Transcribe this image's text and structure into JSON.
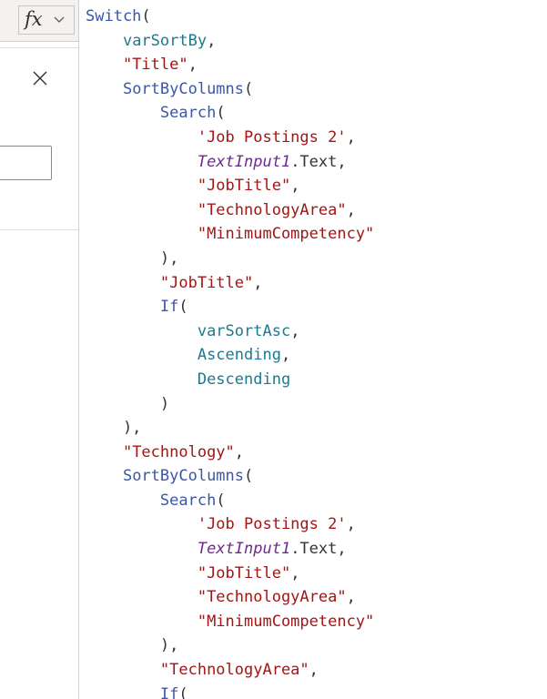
{
  "formula_bar": {
    "fx_label": "fx",
    "icons": [
      "chevron-down-icon",
      "close-icon"
    ]
  },
  "code_lines": [
    [
      {
        "t": "fn",
        "v": "Switch"
      },
      {
        "t": "plain",
        "v": "("
      }
    ],
    [
      {
        "t": "plain",
        "v": "    "
      },
      {
        "t": "var",
        "v": "varSortBy"
      },
      {
        "t": "plain",
        "v": ","
      }
    ],
    [
      {
        "t": "plain",
        "v": "    "
      },
      {
        "t": "str",
        "v": "\"Title\""
      },
      {
        "t": "plain",
        "v": ","
      }
    ],
    [
      {
        "t": "plain",
        "v": "    "
      },
      {
        "t": "fn",
        "v": "SortByColumns"
      },
      {
        "t": "plain",
        "v": "("
      }
    ],
    [
      {
        "t": "plain",
        "v": "        "
      },
      {
        "t": "fn",
        "v": "Search"
      },
      {
        "t": "plain",
        "v": "("
      }
    ],
    [
      {
        "t": "plain",
        "v": "            "
      },
      {
        "t": "str",
        "v": "'Job Postings 2'"
      },
      {
        "t": "plain",
        "v": ","
      }
    ],
    [
      {
        "t": "plain",
        "v": "            "
      },
      {
        "t": "ctl",
        "v": "TextInput1"
      },
      {
        "t": "plain",
        "v": ".Text,"
      }
    ],
    [
      {
        "t": "plain",
        "v": "            "
      },
      {
        "t": "str",
        "v": "\"JobTitle\""
      },
      {
        "t": "plain",
        "v": ","
      }
    ],
    [
      {
        "t": "plain",
        "v": "            "
      },
      {
        "t": "str",
        "v": "\"TechnologyArea\""
      },
      {
        "t": "plain",
        "v": ","
      }
    ],
    [
      {
        "t": "plain",
        "v": "            "
      },
      {
        "t": "str",
        "v": "\"MinimumCompetency\""
      }
    ],
    [
      {
        "t": "plain",
        "v": "        ),"
      }
    ],
    [
      {
        "t": "plain",
        "v": "        "
      },
      {
        "t": "str",
        "v": "\"JobTitle\""
      },
      {
        "t": "plain",
        "v": ","
      }
    ],
    [
      {
        "t": "plain",
        "v": "        "
      },
      {
        "t": "fn",
        "v": "If"
      },
      {
        "t": "plain",
        "v": "("
      }
    ],
    [
      {
        "t": "plain",
        "v": "            "
      },
      {
        "t": "var",
        "v": "varSortAsc"
      },
      {
        "t": "plain",
        "v": ","
      }
    ],
    [
      {
        "t": "plain",
        "v": "            "
      },
      {
        "t": "var",
        "v": "Ascending"
      },
      {
        "t": "plain",
        "v": ","
      }
    ],
    [
      {
        "t": "plain",
        "v": "            "
      },
      {
        "t": "var",
        "v": "Descending"
      }
    ],
    [
      {
        "t": "plain",
        "v": "        )"
      }
    ],
    [
      {
        "t": "plain",
        "v": "    ),"
      }
    ],
    [
      {
        "t": "plain",
        "v": "    "
      },
      {
        "t": "str",
        "v": "\"Technology\""
      },
      {
        "t": "plain",
        "v": ","
      }
    ],
    [
      {
        "t": "plain",
        "v": "    "
      },
      {
        "t": "fn",
        "v": "SortByColumns"
      },
      {
        "t": "plain",
        "v": "("
      }
    ],
    [
      {
        "t": "plain",
        "v": "        "
      },
      {
        "t": "fn",
        "v": "Search"
      },
      {
        "t": "plain",
        "v": "("
      }
    ],
    [
      {
        "t": "plain",
        "v": "            "
      },
      {
        "t": "str",
        "v": "'Job Postings 2'"
      },
      {
        "t": "plain",
        "v": ","
      }
    ],
    [
      {
        "t": "plain",
        "v": "            "
      },
      {
        "t": "ctl",
        "v": "TextInput1"
      },
      {
        "t": "plain",
        "v": ".Text,"
      }
    ],
    [
      {
        "t": "plain",
        "v": "            "
      },
      {
        "t": "str",
        "v": "\"JobTitle\""
      },
      {
        "t": "plain",
        "v": ","
      }
    ],
    [
      {
        "t": "plain",
        "v": "            "
      },
      {
        "t": "str",
        "v": "\"TechnologyArea\""
      },
      {
        "t": "plain",
        "v": ","
      }
    ],
    [
      {
        "t": "plain",
        "v": "            "
      },
      {
        "t": "str",
        "v": "\"MinimumCompetency\""
      }
    ],
    [
      {
        "t": "plain",
        "v": "        ),"
      }
    ],
    [
      {
        "t": "plain",
        "v": "        "
      },
      {
        "t": "str",
        "v": "\"TechnologyArea\""
      },
      {
        "t": "plain",
        "v": ","
      }
    ],
    [
      {
        "t": "plain",
        "v": "        "
      },
      {
        "t": "fn",
        "v": "If"
      },
      {
        "t": "plain",
        "v": "("
      }
    ]
  ],
  "colors": {
    "function": "#3a56a8",
    "variable": "#1d7a8c",
    "string": "#a31515",
    "control": "#6c2a8a",
    "plain": "#333333"
  }
}
